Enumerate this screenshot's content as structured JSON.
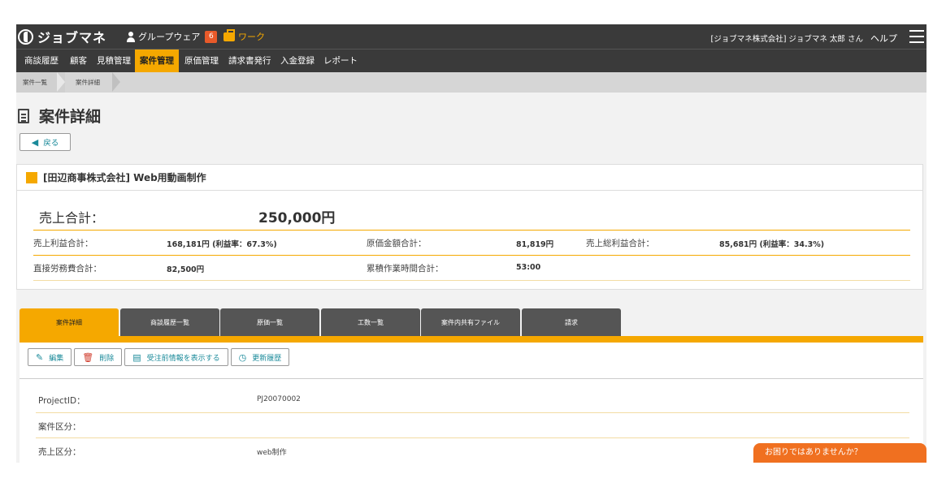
{
  "app": {
    "logo_text": "ジョブマネ",
    "groupware_label": "グループウェア",
    "groupware_badge": "6",
    "work_label": "ワーク",
    "user_label": "[ジョブマネ株式会社] ジョブマネ 太郎 さん",
    "help_label": "ヘルプ"
  },
  "nav": {
    "items": [
      "商談履歴",
      "顧客",
      "見積管理",
      "案件管理",
      "原価管理",
      "請求書発行",
      "入金登録",
      "レポート"
    ],
    "active": "案件管理"
  },
  "breadcrumb": [
    "案件一覧",
    "案件詳細"
  ],
  "page": {
    "title": "案件詳細",
    "back_label": "戻る"
  },
  "project": {
    "title": "[田辺商事株式会社] Web用動画制作",
    "sales_total_label": "売上合計：",
    "sales_total_value": "250,000円",
    "gross_profit_label": "売上利益合計：",
    "gross_profit_value": "168,181円 (利益率：67.3%)",
    "cost_label": "原価金額合計：",
    "cost_value": "81,819円",
    "total_gross_label": "売上総利益合計：",
    "total_gross_value": "85,681円 (利益率：34.3%)",
    "labor_label": "直接労務費合計：",
    "labor_value": "82,500円",
    "hours_label": "累積作業時間合計：",
    "hours_value": "53:00"
  },
  "tabs": [
    "案件詳細",
    "商談履歴一覧",
    "原価一覧",
    "工数一覧",
    "案件内共有ファイル",
    "請求"
  ],
  "toolbar": {
    "edit": "編集",
    "delete": "削除",
    "show_pre_order": "受注前情報を表示する",
    "history": "更新履歴"
  },
  "detail": {
    "project_id_label": "ProjectID：",
    "project_id_value": "PJ20070002",
    "category_label": "案件区分：",
    "category_value": "",
    "sales_category_label": "売上区分：",
    "sales_category_value": "web制作"
  },
  "help_bubble": "お困りではありませんか？",
  "colors": {
    "accent": "#f5a800",
    "topbar": "#3a3a3a",
    "link": "#1a8a9a",
    "help": "#f07020"
  }
}
